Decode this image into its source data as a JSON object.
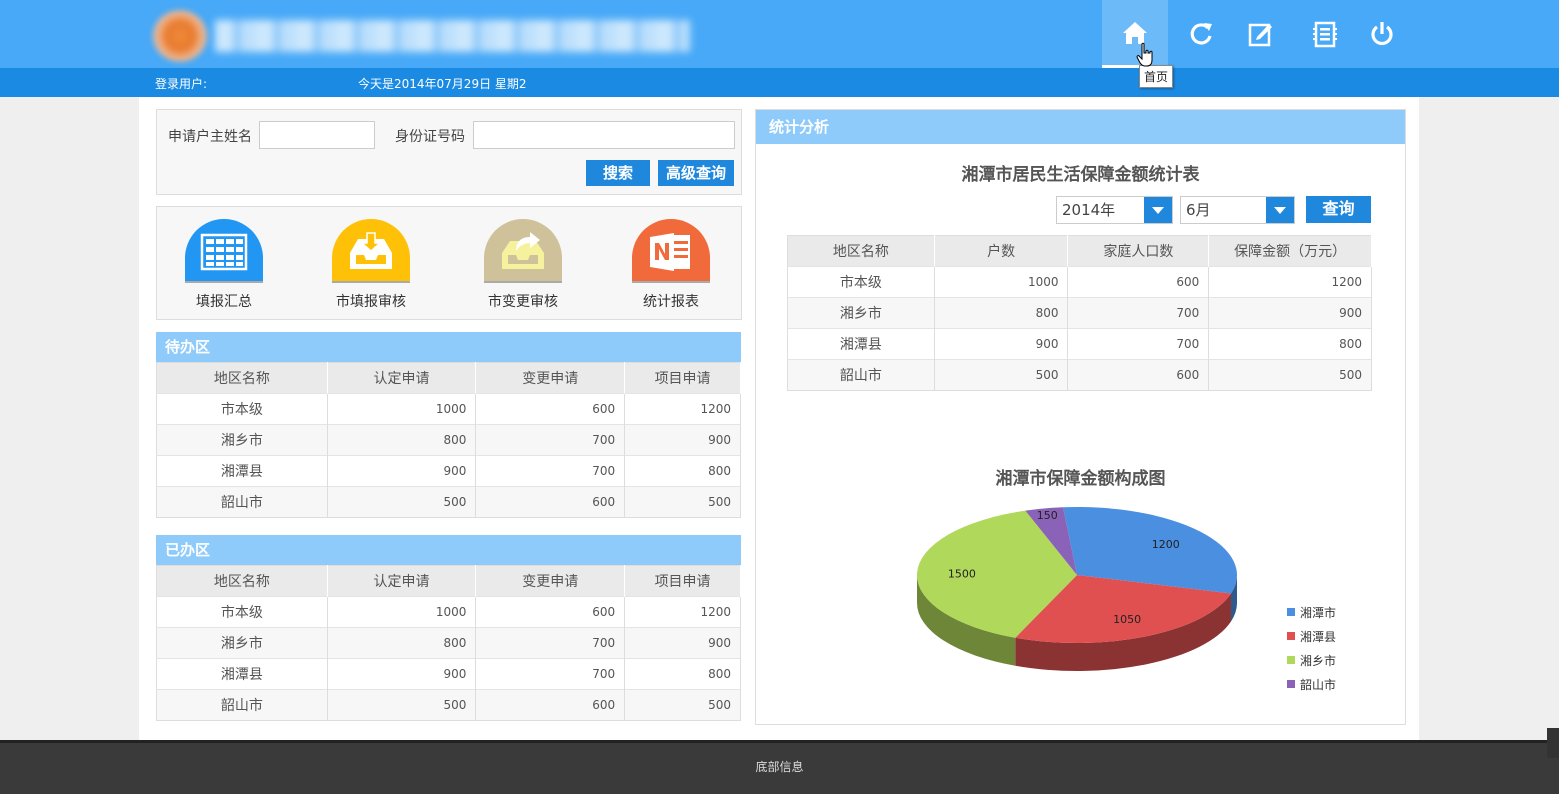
{
  "header": {
    "nav": [
      {
        "name": "home",
        "tooltip": "首页"
      },
      {
        "name": "refresh"
      },
      {
        "name": "edit"
      },
      {
        "name": "list"
      },
      {
        "name": "power"
      }
    ],
    "login_label": "登录用户:",
    "date_text": "今天是2014年07月29日 星期2"
  },
  "search": {
    "name_label": "申请户主姓名",
    "name_value": "",
    "id_label": "身份证号码",
    "id_value": "",
    "search_btn": "搜索",
    "advanced_btn": "高级查询"
  },
  "shortcuts": [
    {
      "label": "填报汇总",
      "color": "#2196f3",
      "icon": "table-icon"
    },
    {
      "label": "市填报审核",
      "color": "#ffc107",
      "icon": "inbox-in-icon"
    },
    {
      "label": "市变更审核",
      "color": "#cfc19a",
      "icon": "inbox-out-icon"
    },
    {
      "label": "统计报表",
      "color": "#f06a3b",
      "icon": "onenote-icon"
    }
  ],
  "todo": {
    "title": "待办区",
    "columns": [
      "地区名称",
      "认定申请",
      "变更申请",
      "项目申请"
    ],
    "rows": [
      [
        "市本级",
        "1000",
        "600",
        "1200"
      ],
      [
        "湘乡市",
        "800",
        "700",
        "900"
      ],
      [
        "湘潭县",
        "900",
        "700",
        "800"
      ],
      [
        "韶山市",
        "500",
        "600",
        "500"
      ]
    ]
  },
  "done": {
    "title": "已办区",
    "columns": [
      "地区名称",
      "认定申请",
      "变更申请",
      "项目申请"
    ],
    "rows": [
      [
        "市本级",
        "1000",
        "600",
        "1200"
      ],
      [
        "湘乡市",
        "800",
        "700",
        "900"
      ],
      [
        "湘潭县",
        "900",
        "700",
        "800"
      ],
      [
        "韶山市",
        "500",
        "600",
        "500"
      ]
    ]
  },
  "stats": {
    "title": "统计分析",
    "table_title": "湘潭市居民生活保障金额统计表",
    "year": "2014年",
    "month": "6月",
    "query_btn": "查询",
    "columns": [
      "地区名称",
      "户数",
      "家庭人口数",
      "保障金额（万元）"
    ],
    "rows": [
      [
        "市本级",
        "1000",
        "600",
        "1200"
      ],
      [
        "湘乡市",
        "800",
        "700",
        "900"
      ],
      [
        "湘潭县",
        "900",
        "700",
        "800"
      ],
      [
        "韶山市",
        "500",
        "600",
        "500"
      ]
    ],
    "chart_title": "湘潭市保障金额构成图"
  },
  "chart_data": {
    "type": "pie",
    "title": "湘潭市保障金额构成图",
    "categories": [
      "湘潭市",
      "湘潭县",
      "湘乡市",
      "韶山市"
    ],
    "values": [
      1200,
      1050,
      1500,
      150
    ],
    "colors": [
      "#4a8fe0",
      "#e05050",
      "#b0d85a",
      "#8a63b8"
    ],
    "legend": "right"
  },
  "footer": {
    "text": "底部信息"
  }
}
